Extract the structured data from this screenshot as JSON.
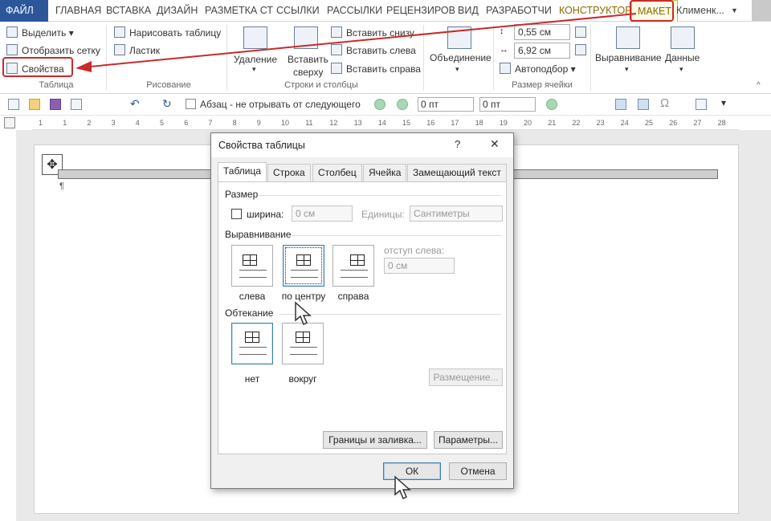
{
  "ribbon_tabs": [
    "ФАЙЛ",
    "ГЛАВНАЯ",
    "ВСТАВКА",
    "ДИЗАЙН",
    "РАЗМЕТКА СТ",
    "ССЫЛКИ",
    "РАССЫЛКИ",
    "РЕЦЕНЗИРОВ",
    "ВИД",
    "РАЗРАБОТЧИ",
    "КОНСТРУКТОР",
    "МАКЕТ"
  ],
  "user_name": "Клименк...",
  "ribbon": {
    "table_group": {
      "select": "Выделить",
      "show_grid": "Отобразить сетку",
      "properties": "Свойства",
      "label": "Таблица"
    },
    "draw_group": {
      "draw_table": "Нарисовать таблицу",
      "eraser": "Ластик",
      "label": "Рисование"
    },
    "rows_cols_group": {
      "delete": "Удаление",
      "insert_above_1": "Вставить",
      "insert_above_2": "сверху",
      "insert_below": "Вставить снизу",
      "insert_left": "Вставить слева",
      "insert_right": "Вставить справа",
      "label": "Строки и столбцы"
    },
    "merge_group": {
      "merge": "Объединение"
    },
    "cell_size_group": {
      "height": "0,55 см",
      "width": "6,92 см",
      "autofit": "Автоподбор",
      "label": "Размер ячейки"
    },
    "align_group": {
      "align": "Выравнивание"
    },
    "data_group": {
      "data": "Данные"
    }
  },
  "qat": {
    "keep_with_next": "Абзац - не отрывать от следующего",
    "spacing_before": "0 пт",
    "spacing_after": "0 пт"
  },
  "ruler_ticks": [
    "1",
    "1",
    "2",
    "3",
    "4",
    "5",
    "6",
    "7",
    "8",
    "9",
    "10",
    "11",
    "12",
    "13",
    "14",
    "15",
    "16",
    "17",
    "18",
    "19",
    "20",
    "21",
    "22",
    "23",
    "24",
    "25",
    "26",
    "27",
    "28"
  ],
  "dialog": {
    "title": "Свойства таблицы",
    "help": "?",
    "close": "✕",
    "tabs": [
      "Таблица",
      "Строка",
      "Столбец",
      "Ячейка",
      "Замещающий текст"
    ],
    "size_section": "Размер",
    "width_label": "ширина:",
    "width_value": "0 см",
    "units_label": "Единицы:",
    "units_value": "Сантиметры",
    "align_section": "Выравнивание",
    "align_left": "слева",
    "align_center": "по центру",
    "align_right": "справа",
    "indent_label": "отступ слева:",
    "indent_value": "0 см",
    "wrap_section": "Обтекание",
    "wrap_none": "нет",
    "wrap_around": "вокруг",
    "positioning": "Размещение...",
    "borders": "Границы и заливка...",
    "options": "Параметры...",
    "ok": "ОК",
    "cancel": "Отмена"
  },
  "colors": {
    "file_tab": "#2b579a",
    "annotation_red": "#c92a2a",
    "context_tab": "#8a6a00"
  }
}
